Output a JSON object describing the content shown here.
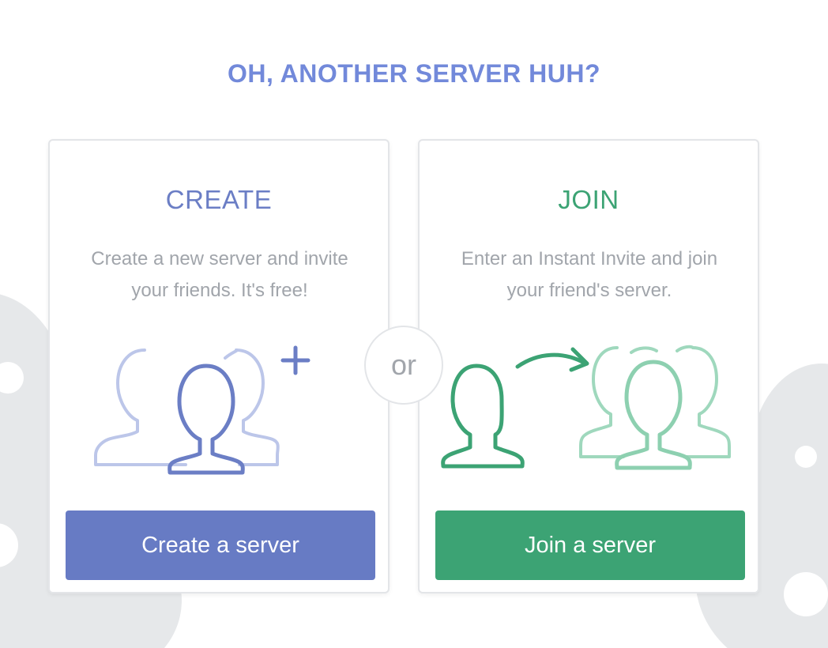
{
  "page": {
    "title": "OH, ANOTHER SERVER HUH?"
  },
  "create": {
    "heading": "CREATE",
    "description": "Create a new server and invite your friends. It's free!",
    "button_label": "Create a server",
    "illustration_icon": "create-server-users-plus-icon"
  },
  "divider": {
    "label": "or"
  },
  "join": {
    "heading": "JOIN",
    "description": "Enter an Instant Invite and join your friend's server.",
    "button_label": "Join a server",
    "illustration_icon": "join-server-user-arrow-icon"
  },
  "colors": {
    "title": "#7289da",
    "create_accent": "#6b7ec5",
    "create_button": "#677bc4",
    "join_accent": "#3ca374",
    "join_button": "#3ca374",
    "description_text": "#a1a5ab",
    "card_border": "#e3e5e8",
    "background_art": "#e6e8ea"
  }
}
